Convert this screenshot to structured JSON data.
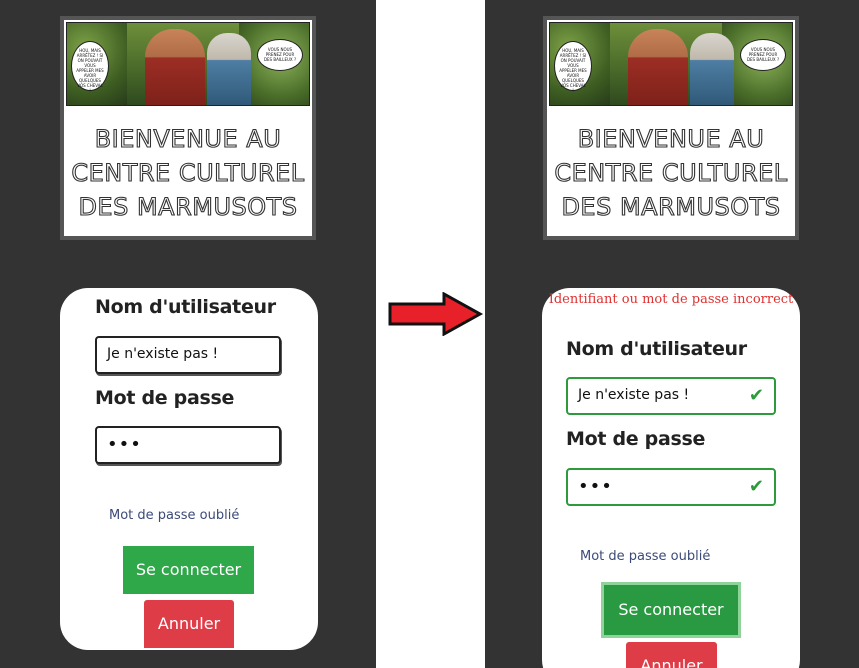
{
  "banner": {
    "welcome_line1": "BIENVENUE AU",
    "welcome_line2": "CENTRE CULTUREL",
    "welcome_line3": "DES MARMUSOTS",
    "comic_bubble_left": "HOU, MAIS ARRÊTEZ ! SI ON POUVAIT VOUS APPELER MES AVOIR QUELQUES VOS CHEVAL !",
    "comic_bubble_right": "VOUS NOUS PRENEZ POUR DES BAILLEUX ?"
  },
  "before": {
    "username_label": "Nom d'utilisateur",
    "username_value": "Je n'existe pas !",
    "password_label": "Mot de passe",
    "password_value": "•••",
    "forgot_link": "Mot de passe oublié",
    "connect_button": "Se connecter",
    "cancel_button": "Annuler"
  },
  "after": {
    "error_message": "Identifiant ou mot de passe incorrect",
    "username_label": "Nom d'utilisateur",
    "username_value": "Je n'existe pas !",
    "password_label": "Mot de passe",
    "password_value": "•••",
    "forgot_link": "Mot de passe oublié",
    "connect_button": "Se connecter",
    "cancel_button": "Annuler"
  },
  "icons": {
    "arrow": "right-arrow-icon",
    "valid": "checkmark-icon"
  },
  "colors": {
    "panel": "#333333",
    "success": "#2fa84a",
    "danger": "#de3c46",
    "error_text": "#e03030",
    "arrow": "#e8202a"
  }
}
